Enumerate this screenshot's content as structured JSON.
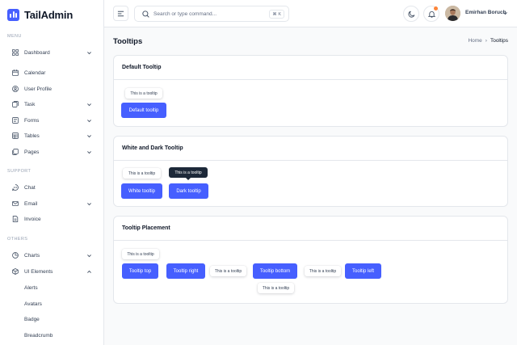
{
  "brand": {
    "name": "TailAdmin",
    "accent": "#465FFF"
  },
  "sidebar": {
    "sections": {
      "menu": "MENU",
      "support": "SUPPORT",
      "others": "OTHERS"
    },
    "items": [
      {
        "label": "Dashboard",
        "icon": "grid-icon",
        "has_chevron": true
      },
      {
        "label": "Calendar",
        "icon": "calendar-icon",
        "has_chevron": false
      },
      {
        "label": "User Profile",
        "icon": "user-circle-icon",
        "has_chevron": false
      },
      {
        "label": "Task",
        "icon": "task-icon",
        "has_chevron": true
      },
      {
        "label": "Forms",
        "icon": "forms-icon",
        "has_chevron": true
      },
      {
        "label": "Tables",
        "icon": "table-icon",
        "has_chevron": true
      },
      {
        "label": "Pages",
        "icon": "pages-icon",
        "has_chevron": true
      },
      {
        "label": "Chat",
        "icon": "chat-icon",
        "has_chevron": false
      },
      {
        "label": "Email",
        "icon": "mail-icon",
        "has_chevron": true
      },
      {
        "label": "Invoice",
        "icon": "invoice-icon",
        "has_chevron": false
      },
      {
        "label": "Charts",
        "icon": "pie-chart-icon",
        "has_chevron": true
      },
      {
        "label": "UI Elements",
        "icon": "box-icon",
        "has_chevron": true
      }
    ],
    "sub_items": [
      "Alerts",
      "Avatars",
      "Badge",
      "Breadcrumb"
    ]
  },
  "header": {
    "search_placeholder": "Search or type command...",
    "search_shortcut": "⌘ K",
    "user_name": "Emirhan Boruch"
  },
  "page": {
    "title": "Tooltips",
    "breadcrumb": {
      "home": "Home",
      "separator": "›",
      "current": "Tooltips"
    }
  },
  "cards": {
    "default": {
      "title": "Default Tooltip",
      "tooltip": "This is a tooltip",
      "button": "Default tooltip"
    },
    "white_dark": {
      "title": "White and Dark Tooltip",
      "white_tooltip": "This is a tooltip",
      "white_button": "White tooltip",
      "dark_tooltip": "This is a tooltip",
      "dark_button": "Dark tooltip"
    },
    "placement": {
      "title": "Tooltip Placement",
      "top_tooltip": "This is a tooltip",
      "top_button": "Tooltip top",
      "right_button": "Tooltip right",
      "right_tooltip": "This is a tooltip",
      "bottom_button": "Tooltip bottom",
      "bottom_tooltip": "This is a tooltip",
      "left_tooltip": "This is a tooltip",
      "left_button": "Tooltip left"
    }
  }
}
